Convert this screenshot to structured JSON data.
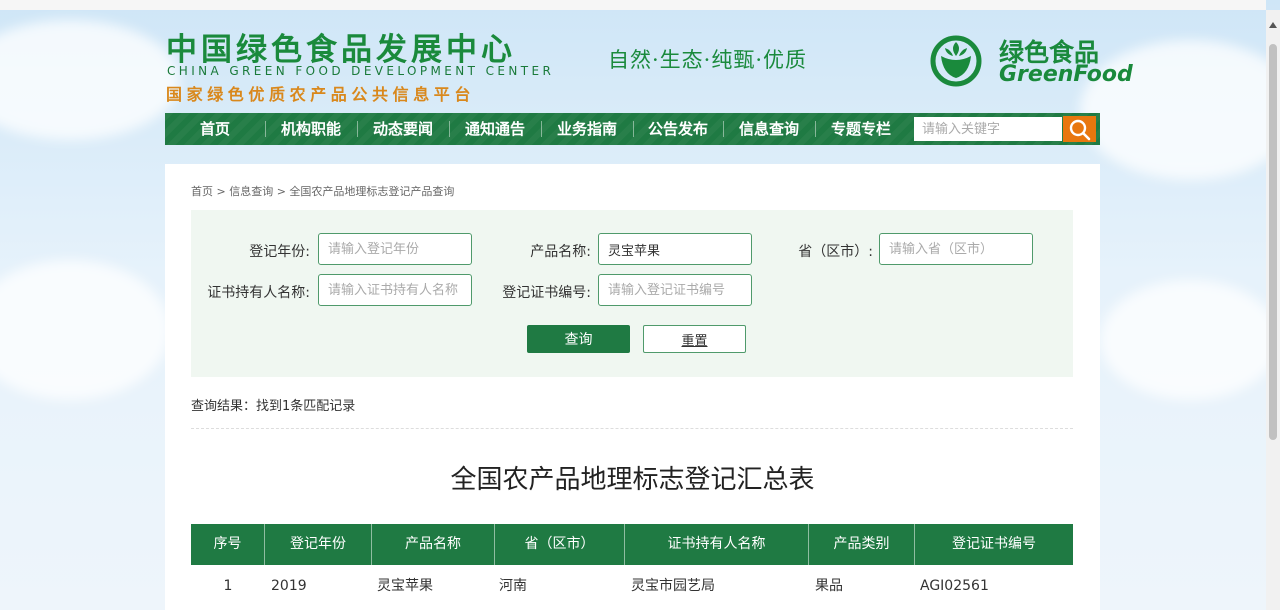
{
  "header": {
    "logo_cn": "中国绿色食品发展中心",
    "logo_en": "CHINA GREEN FOOD DEVELOPMENT CENTER",
    "logo_sub": "国家绿色优质农产品公共信息平台",
    "slogan": "自然·生态·纯甄·优质",
    "brand_cn": "绿色食品",
    "brand_en": "GreenFood",
    "brand_color": "#1a8a3c"
  },
  "nav": {
    "items": [
      "首页",
      "机构职能",
      "动态要闻",
      "通知通告",
      "业务指南",
      "公告发布",
      "信息查询",
      "专题专栏"
    ],
    "search_placeholder": "请输入关键字",
    "search_icon": "search-icon",
    "nav_color": "#1f7a43",
    "search_button_color": "#e8770e"
  },
  "breadcrumb": "首页 > 信息查询 > 全国农产品地理标志登记产品查询",
  "form": {
    "year_label": "登记年份:",
    "year_placeholder": "请输入登记年份",
    "year_value": "",
    "product_label": "产品名称:",
    "product_value": "灵宝苹果",
    "province_label": "省（区市）:",
    "province_placeholder": "请输入省（区市）",
    "holder_label": "证书持有人名称:",
    "holder_placeholder": "请输入证书持有人名称",
    "cert_label": "登记证书编号:",
    "cert_placeholder": "请输入登记证书编号",
    "query_button": "查询",
    "reset_button": "重置"
  },
  "result_text": "查询结果：找到1条匹配记录",
  "table": {
    "title": "全国农产品地理标志登记汇总表",
    "headers": [
      "序号",
      "登记年份",
      "产品名称",
      "省（区市）",
      "证书持有人名称",
      "产品类别",
      "登记证书编号"
    ],
    "rows": [
      [
        "1",
        "2019",
        "灵宝苹果",
        "河南",
        "灵宝市园艺局",
        "果品",
        "AGI02561"
      ]
    ]
  }
}
